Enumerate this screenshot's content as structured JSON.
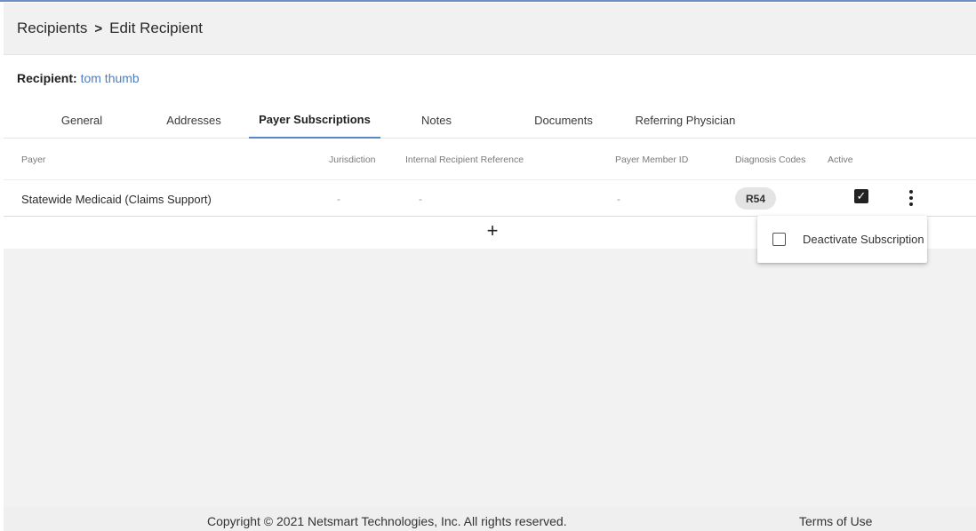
{
  "breadcrumb": {
    "parent": "Recipients",
    "separator": ">",
    "current": "Edit Recipient"
  },
  "recipient": {
    "label": "Recipient:",
    "name": "tom thumb"
  },
  "tabs": [
    {
      "label": "General"
    },
    {
      "label": "Addresses"
    },
    {
      "label": "Payer Subscriptions",
      "active": true
    },
    {
      "label": "Notes"
    },
    {
      "label": "Documents"
    },
    {
      "label": "Referring Physician"
    }
  ],
  "table": {
    "headers": {
      "payer": "Payer",
      "jurisdiction": "Jurisdiction",
      "internal_ref": "Internal Recipient Reference",
      "member_id": "Payer Member ID",
      "diagnosis": "Diagnosis Codes",
      "active": "Active"
    },
    "rows": [
      {
        "payer": "Statewide Medicaid (Claims Support)",
        "jurisdiction": "-",
        "internal_ref": "-",
        "member_id": "-",
        "diagnosis": "R54",
        "active": true
      }
    ],
    "add_symbol": "+"
  },
  "row_menu": {
    "item": "Deactivate Subscription"
  },
  "icons": {
    "checkbox_checked": "check-icon",
    "more": "kebab-icon",
    "add": "plus-icon"
  },
  "colors": {
    "link": "#4f7dbf",
    "tab_underline": "#5a87c5",
    "chip_bg": "#e4e4e4"
  },
  "footer": {
    "copyright": "Copyright © 2021 Netsmart Technologies, Inc. All rights reserved.",
    "terms": "Terms of Use"
  }
}
